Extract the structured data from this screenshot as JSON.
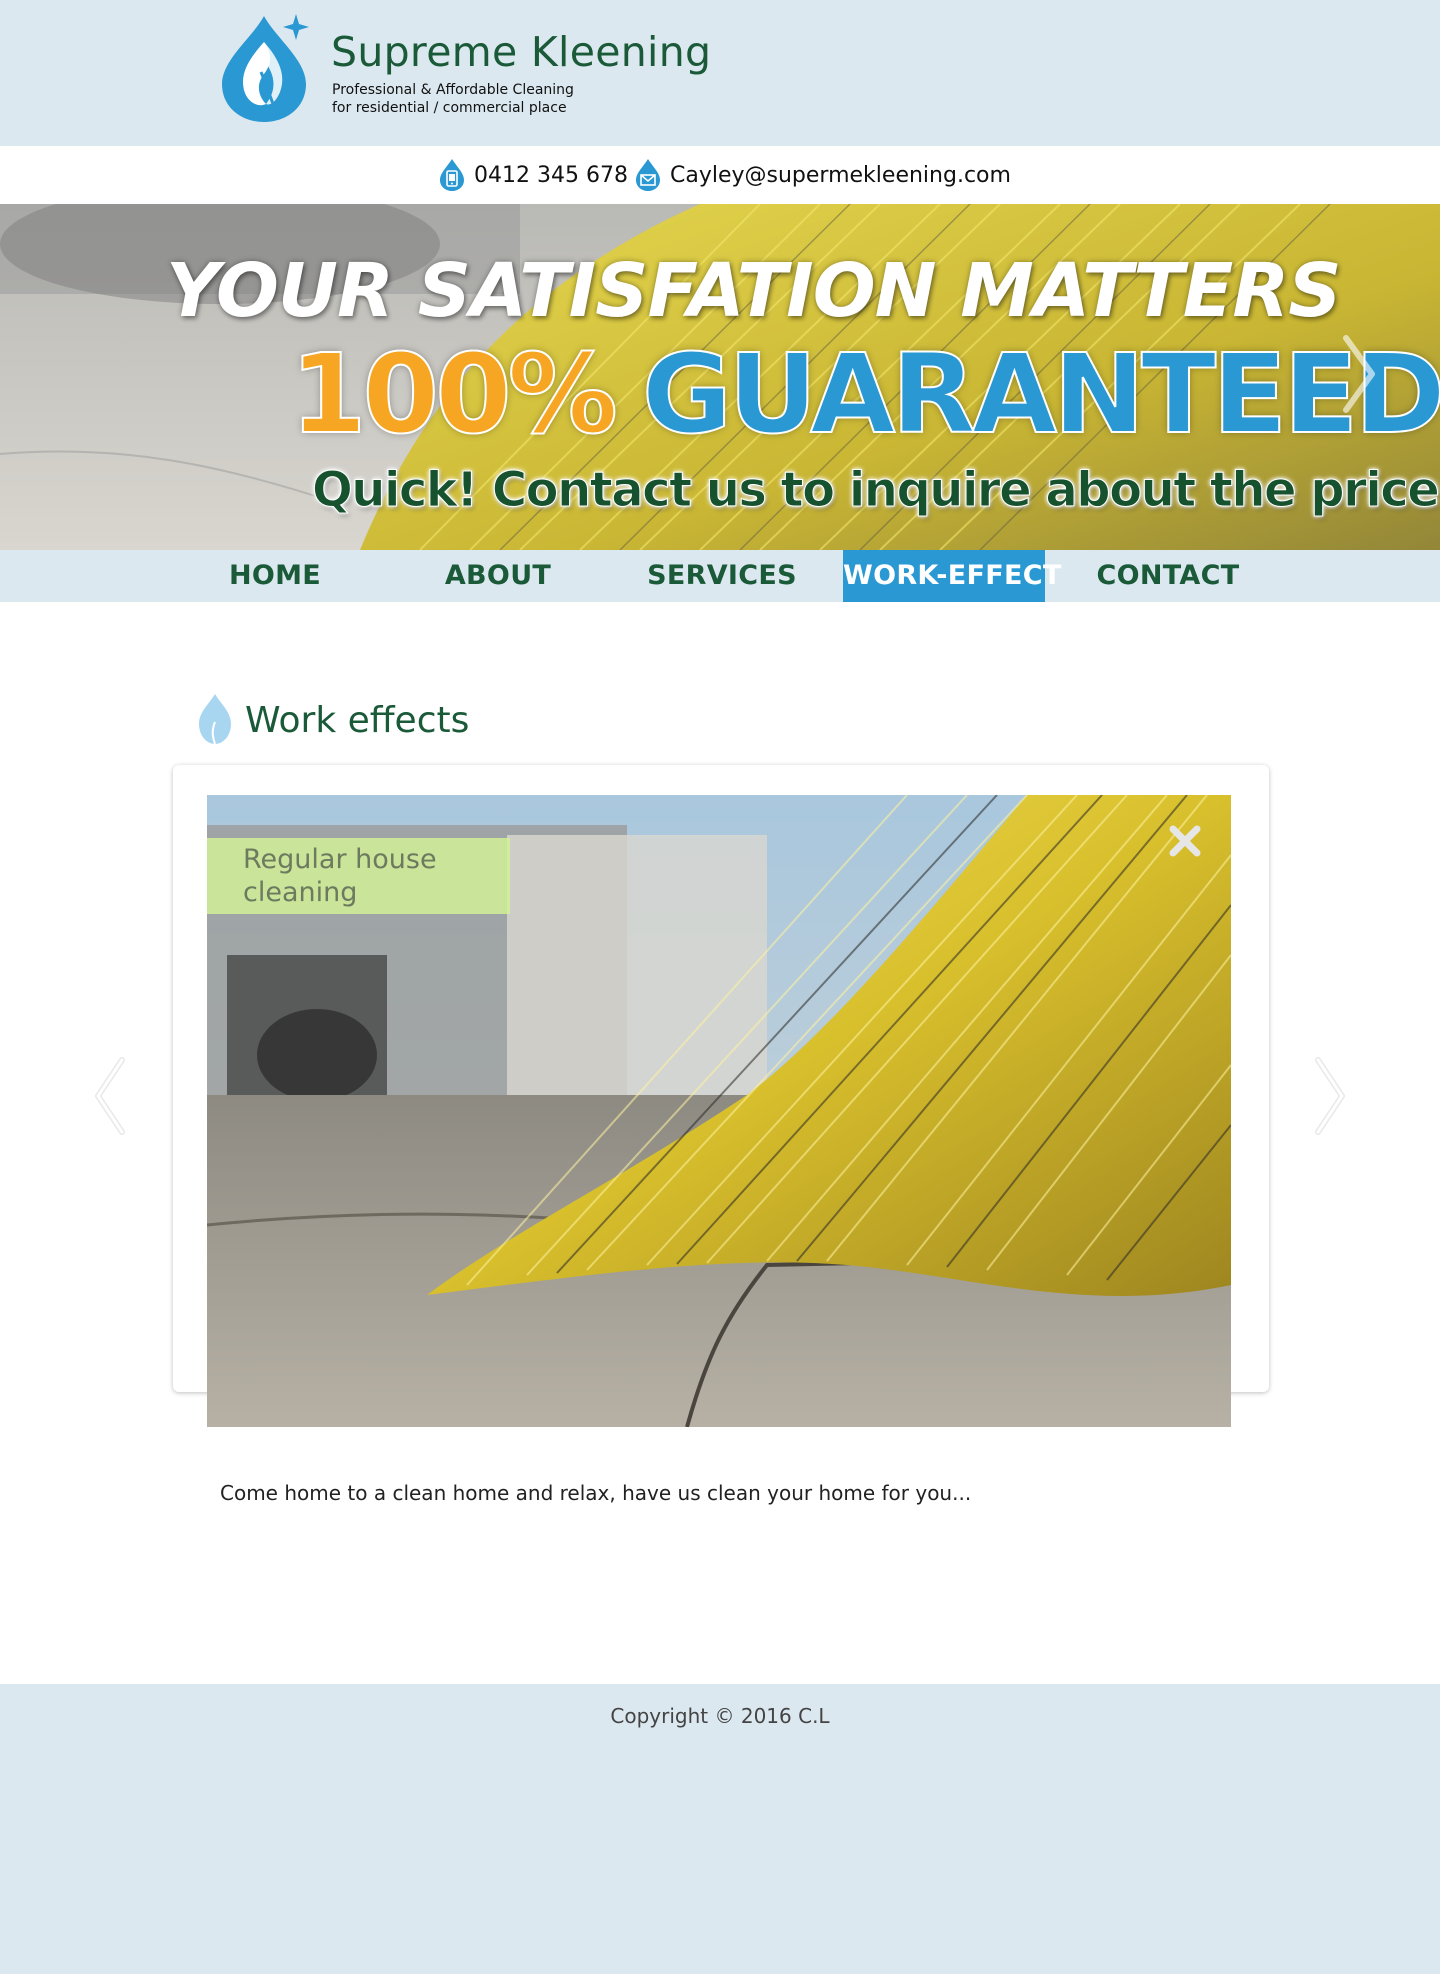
{
  "brand": {
    "name": "Supreme Kleening",
    "tagline_line1": "Professional & Affordable Cleaning",
    "tagline_line2": "for residential / commercial place"
  },
  "contact": {
    "phone": "0412 345 678",
    "email": "Cayley@supermekleening.com"
  },
  "hero": {
    "line1": "YOUR SATISFATION MATTERS",
    "line2_highlight": "100%",
    "line2_rest": "GUARANTEED",
    "line3": "Quick! Contact us to inquire about the price!"
  },
  "nav": {
    "items": [
      {
        "label": "HOME"
      },
      {
        "label": "ABOUT"
      },
      {
        "label": "SERVICES"
      },
      {
        "label": "WORK-EFFECT"
      },
      {
        "label": "CONTACT"
      }
    ],
    "active": "WORK-EFFECT"
  },
  "section": {
    "title": "Work effects"
  },
  "gallery": {
    "caption": "Regular house cleaning",
    "description": "Come home to a clean home and relax, have us clean your home for you..."
  },
  "footer": {
    "copyright": "Copyright © 2016 C.L"
  },
  "colors": {
    "brand_green": "#1a5a38",
    "accent_blue": "#2a98d3",
    "page_bg": "#dce8f0",
    "hero_orange": "#f6a623"
  }
}
